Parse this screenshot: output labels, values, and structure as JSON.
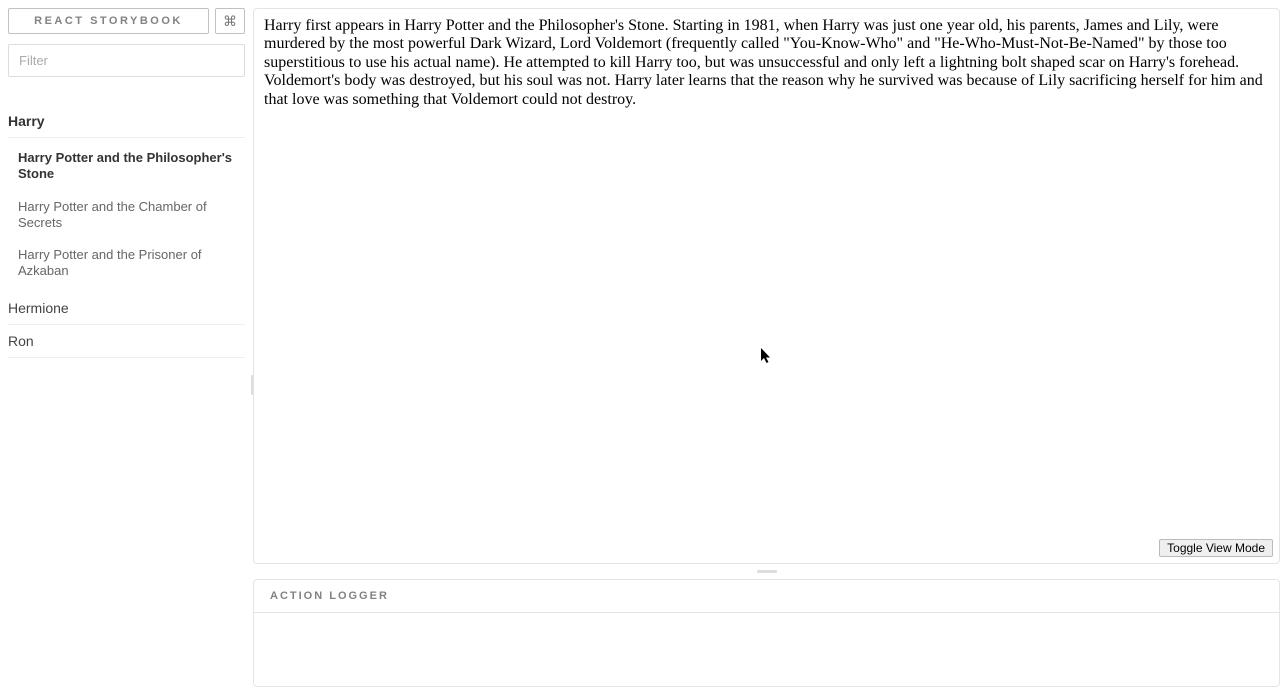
{
  "header": {
    "logo_label": "REACT STORYBOOK",
    "cmd_glyph": "⌘"
  },
  "filter": {
    "placeholder": "Filter",
    "value": ""
  },
  "sidebar": {
    "groups": [
      {
        "name": "Harry",
        "active": true,
        "stories": [
          {
            "label": "Harry Potter and the Philosopher's Stone",
            "active": true
          },
          {
            "label": "Harry Potter and the Chamber of Secrets",
            "active": false
          },
          {
            "label": "Harry Potter and the Prisoner of Azkaban",
            "active": false
          }
        ]
      },
      {
        "name": "Hermione",
        "active": false,
        "stories": []
      },
      {
        "name": "Ron",
        "active": false,
        "stories": []
      }
    ]
  },
  "preview": {
    "body": "Harry first appears in Harry Potter and the Philosopher's Stone. Starting in 1981, when Harry was just one year old, his parents, James and Lily, were murdered by the most powerful Dark Wizard, Lord Voldemort (frequently called \"You-Know-Who\" and \"He-Who-Must-Not-Be-Named\" by those too superstitious to use his actual name). He attempted to kill Harry too, but was unsuccessful and only left a lightning bolt shaped scar on Harry's forehead. Voldemort's body was destroyed, but his soul was not. Harry later learns that the reason why he survived was because of Lily sacrificing herself for him and that love was something that Voldemort could not destroy.",
    "toggle_label": "Toggle View Mode"
  },
  "panel": {
    "header": "ACTION LOGGER"
  }
}
